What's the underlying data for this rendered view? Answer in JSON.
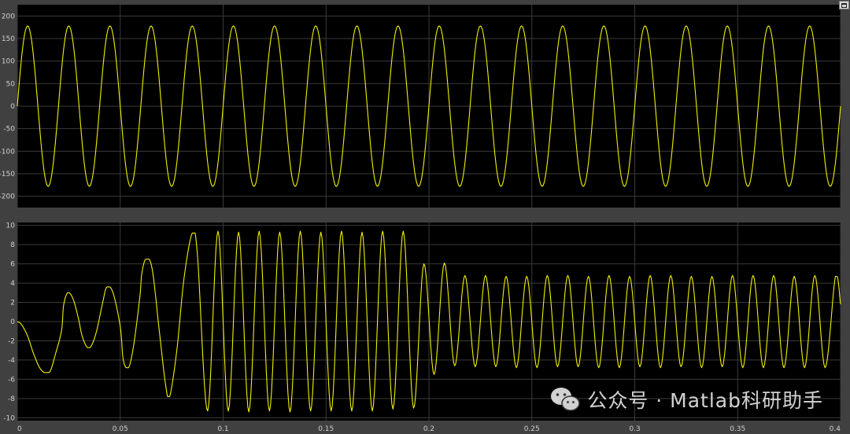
{
  "watermark": {
    "text": "公众号 · Matlab科研助手",
    "icon": "wechat-icon"
  },
  "colors": {
    "background": "#404040",
    "axes": "#000000",
    "grid": "#3a3a3a",
    "line": "#f0f000",
    "tick_text": "#cfcfcf"
  },
  "chart_data": [
    {
      "type": "line",
      "title": "",
      "xlabel": "",
      "ylabel": "",
      "xlim": [
        0,
        0.4
      ],
      "ylim": [
        -225,
        225
      ],
      "xticks": [
        0,
        0.05,
        0.1,
        0.15,
        0.2,
        0.25,
        0.3,
        0.35,
        0.4
      ],
      "yticks": [
        200,
        150,
        100,
        50,
        0,
        -50,
        -100,
        -150,
        -200
      ],
      "grid": true,
      "series": [
        {
          "color": "#f0f000",
          "description": "sinusoid, 50 Hz, amplitude ~178",
          "frequency_hz": 50,
          "amplitude": 178,
          "phase_rad": 0,
          "points_per_period": 40
        }
      ]
    },
    {
      "type": "line",
      "title": "",
      "xlabel": "",
      "ylabel": "",
      "xlim": [
        0,
        0.4
      ],
      "ylim": [
        -10.3,
        10.3
      ],
      "xticks": [
        0,
        0.05,
        0.1,
        0.15,
        0.2,
        0.25,
        0.3,
        0.35,
        0.4
      ],
      "xticklabels": [
        "0",
        "0.05",
        "0.1",
        "0.15",
        "0.2",
        "0.25",
        "0.3",
        "0.35",
        "0.4"
      ],
      "yticks": [
        10,
        8,
        6,
        4,
        2,
        0,
        -2,
        -4,
        -6,
        -8,
        -10
      ],
      "grid": true,
      "series": [
        {
          "color": "#f0f000",
          "x": [
            0,
            0.002,
            0.005,
            0.008,
            0.0115,
            0.0155,
            0.0185,
            0.0215,
            0.0225,
            0.0245,
            0.027,
            0.0295,
            0.0315,
            0.034,
            0.036,
            0.0385,
            0.0415,
            0.0435,
            0.0465,
            0.05,
            0.0515,
            0.054,
            0.0565,
            0.0595,
            0.0605,
            0.0625,
            0.0655,
            0.069,
            0.072,
            0.074,
            0.0775,
            0.081,
            0.085,
            0.0875,
            0.0925,
            0.0975,
            0.1025,
            0.1075,
            0.1125,
            0.1175,
            0.1225,
            0.1275,
            0.1325,
            0.1375,
            0.1425,
            0.1475,
            0.1525,
            0.1575,
            0.1625,
            0.1675,
            0.1725,
            0.1775,
            0.1825,
            0.1875,
            0.1925,
            0.1975,
            0.2025,
            0.2075,
            0.2125,
            0.2175,
            0.2225,
            0.2275,
            0.2325,
            0.2375,
            0.2425,
            0.2475,
            0.2525,
            0.2575,
            0.2625,
            0.2675,
            0.2725,
            0.2775,
            0.2825,
            0.2875,
            0.2925,
            0.2975,
            0.3025,
            0.3075,
            0.3125,
            0.3175,
            0.3225,
            0.3275,
            0.3325,
            0.3375,
            0.3425,
            0.3475,
            0.3525,
            0.3575,
            0.3625,
            0.3675,
            0.3725,
            0.3775,
            0.3825,
            0.3875,
            0.3925,
            0.3975,
            0.4
          ],
          "y": [
            0,
            -0.3,
            -1.5,
            -3.4,
            -5.0,
            -5.3,
            -3.4,
            -0.9,
            1.7,
            3.0,
            2.4,
            0.5,
            -1.5,
            -2.7,
            -2.5,
            -1.0,
            2.0,
            3.6,
            3.0,
            -0.5,
            -4.0,
            -4.8,
            -2.5,
            2.5,
            5.0,
            6.5,
            5.5,
            -1.0,
            -6.5,
            -7.8,
            -3.0,
            4.5,
            9.2,
            7.0,
            -9.3,
            9.4,
            -9.3,
            9.3,
            -9.4,
            9.4,
            -9.3,
            9.3,
            -9.4,
            9.4,
            -9.3,
            9.3,
            -9.3,
            9.4,
            -9.3,
            9.3,
            -9.3,
            9.4,
            -9.1,
            9.4,
            -9.0,
            6.0,
            -5.5,
            6.1,
            -4.6,
            4.8,
            -4.7,
            4.8,
            -4.7,
            4.7,
            -4.8,
            4.7,
            -4.8,
            4.8,
            -4.7,
            4.8,
            -4.7,
            4.7,
            -4.8,
            4.8,
            -4.8,
            4.7,
            -4.7,
            4.8,
            -4.8,
            4.8,
            -4.7,
            4.7,
            -4.8,
            4.7,
            -4.7,
            4.8,
            -4.8,
            4.8,
            -4.8,
            4.8,
            -4.8,
            4.7,
            -4.8,
            4.8,
            -4.8,
            4.7,
            1.8
          ]
        }
      ]
    }
  ]
}
